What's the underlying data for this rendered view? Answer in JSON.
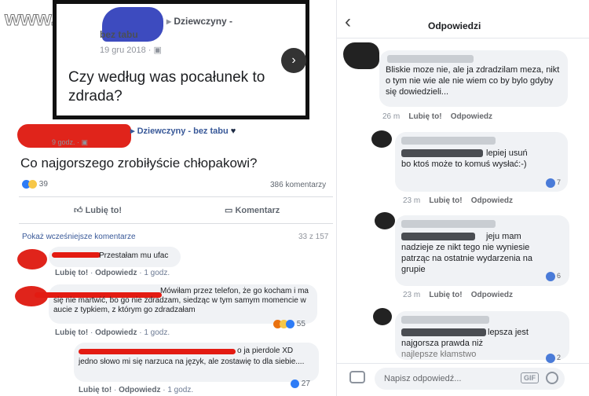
{
  "watermark": "www.wiocha.pl",
  "top_post": {
    "group": "Dziewczyny -",
    "group2": "bez tabu",
    "date": "19 gru 2018 · ",
    "text": "Czy według was pocałunek to zdrada?"
  },
  "left_post": {
    "group": "Dziewczyny - bez tabu",
    "time": "9 godz. · ",
    "text": "Co najgorszego zrobiłyście chłopakowi?",
    "reactions": "39",
    "comments": "386 komentarzy",
    "like": "Lubię to!",
    "comment": "Komentarz",
    "prev": "Pokaż wcześniejsze komentarze",
    "counter": "33 z 157",
    "c1": "Przestałam mu ufac",
    "c1_meta": [
      "Lubię to!",
      "Odpowiedz",
      "1 godz."
    ],
    "c2": "Mówiłam przez telefon, że go kocham i ma się nie martwić, bo go nie zdradzam, siedząc w tym samym momencie w aucie z typkiem, z którym go zdradzałam",
    "c2_count": "55",
    "c2_meta": [
      "Lubię to!",
      "Odpowiedz",
      "1 godz."
    ],
    "c3a": "o ja pierdole XD",
    "c3b": "jedno słowo mi się narzuca na język, ale zostawię to dla siebie....",
    "c3_count": "27",
    "c3_meta": [
      "Lubię to!",
      "Odpowiedz",
      "1 godz."
    ]
  },
  "right": {
    "title": "Odpowiedzi",
    "back": "‹",
    "r1": "Bliskie moze nie, ale ja zdradzilam meza, nikt o tym nie wie ale nie wiem co by bylo gdyby się dowiedzieli...",
    "r1_meta": [
      "26 m",
      "Lubię to!",
      "Odpowiedz"
    ],
    "r2a": "lepiej usuń",
    "r2b": "bo ktoś może to komuś wysłać:-)",
    "r2_count": "7",
    "r2_meta": [
      "23 m",
      "Lubię to!",
      "Odpowiedz"
    ],
    "r3a": "jeju mam",
    "r3b": "nadzieje ze nikt tego nie wyniesie patrząc na ostatnie wydarzenia na grupie",
    "r3_count": "6",
    "r3_meta": [
      "23 m",
      "Lubię to!",
      "Odpowiedz"
    ],
    "r4a": "lepsza jest",
    "r4b": "najgorsza prawda niż",
    "r4c": "najlepsze kłamstwo",
    "r4_count": "2",
    "input_placeholder": "Napisz odpowiedź...",
    "gif": "GIF"
  },
  "colors": {
    "fb_blue": "#385898",
    "red_censor": "#e31b12"
  }
}
